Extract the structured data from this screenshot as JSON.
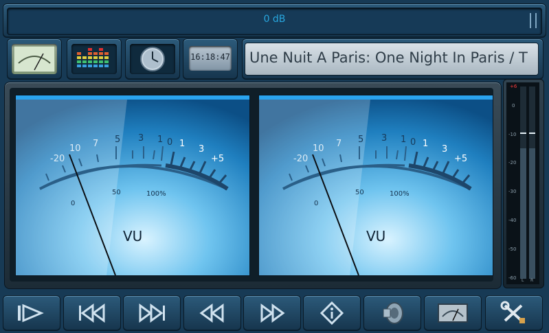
{
  "volume": {
    "label": "0 dB"
  },
  "clock": {
    "time": "16:18:47"
  },
  "track": {
    "title": "Une Nuit A Paris: One Night In Paris / T"
  },
  "vu_left": {
    "label": "VU",
    "upper_scale": [
      "-20",
      "10",
      "7",
      "5",
      "3",
      "1",
      "0",
      "1",
      "3",
      "+5"
    ],
    "lower_scale": [
      "0",
      "50",
      "100%"
    ]
  },
  "vu_right": {
    "label": "VU",
    "upper_scale": [
      "-20",
      "10",
      "7",
      "5",
      "3",
      "1",
      "0",
      "1",
      "3",
      "+5"
    ],
    "lower_scale": [
      "0",
      "50",
      "100%"
    ]
  },
  "peak_meter": {
    "scale": [
      "+6",
      "0",
      "-10",
      "-20",
      "-30",
      "-40",
      "-50",
      "-60"
    ],
    "channels": [
      "L",
      "R"
    ],
    "peak_level_db": -10
  },
  "toolbar": {
    "icons": [
      "play-pause-icon",
      "skip-back-icon",
      "skip-forward-icon",
      "rewind-icon",
      "fast-forward-icon",
      "info-icon",
      "speaker-icon",
      "vu-meter-icon",
      "settings-icon"
    ]
  },
  "colors": {
    "accent": "#28a7df",
    "panel_blue": "#2f8fd0",
    "peak_mark": "#ff3b3b"
  }
}
